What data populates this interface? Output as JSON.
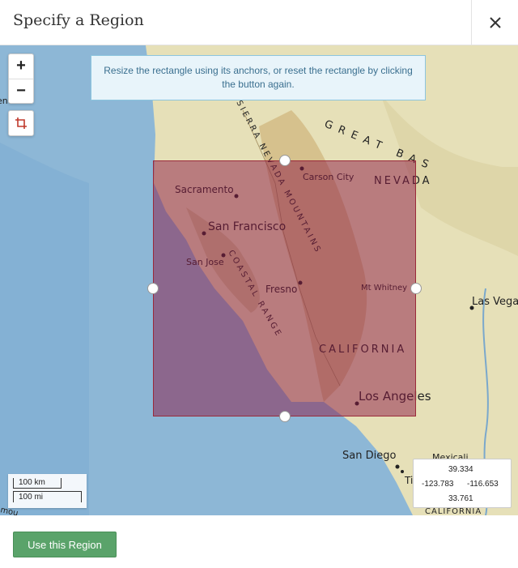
{
  "dialog": {
    "title": "Specify a Region",
    "close_icon": "close-icon"
  },
  "map": {
    "zoom_in_label": "+",
    "zoom_out_label": "−",
    "draw_rectangle_icon": "crop-icon",
    "instruction": "Resize the rectangle using its anchors, or reset the rectangle by clicking the button again.",
    "colors": {
      "ocean": "#8db7d6",
      "land": "#e6e0b8",
      "selection": "#8b1844"
    },
    "labels": {
      "cities": [
        "Sacramento",
        "San Francisco",
        "San Jose",
        "Fresno",
        "Carson City",
        "Mt Whitney",
        "Los Angeles",
        "San Diego",
        "Las Vegas",
        "Mexicali",
        "Ti"
      ],
      "regions": [
        "NEVADA",
        "CALIFORNIA",
        "GREAT BAS",
        "SIERRA NEVADA MOUNTAINS",
        "COASTAL RANGE",
        "CALIFORNIA"
      ],
      "edge_fragment": "ene",
      "bottom_left_fragment": "mou"
    },
    "scale": {
      "km_label": "100 km",
      "mi_label": "100 mi"
    },
    "bounds": {
      "north": "39.334",
      "west": "-123.783",
      "east": "-116.653",
      "south": "33.761"
    }
  },
  "footer": {
    "use_region_label": "Use this Region"
  }
}
